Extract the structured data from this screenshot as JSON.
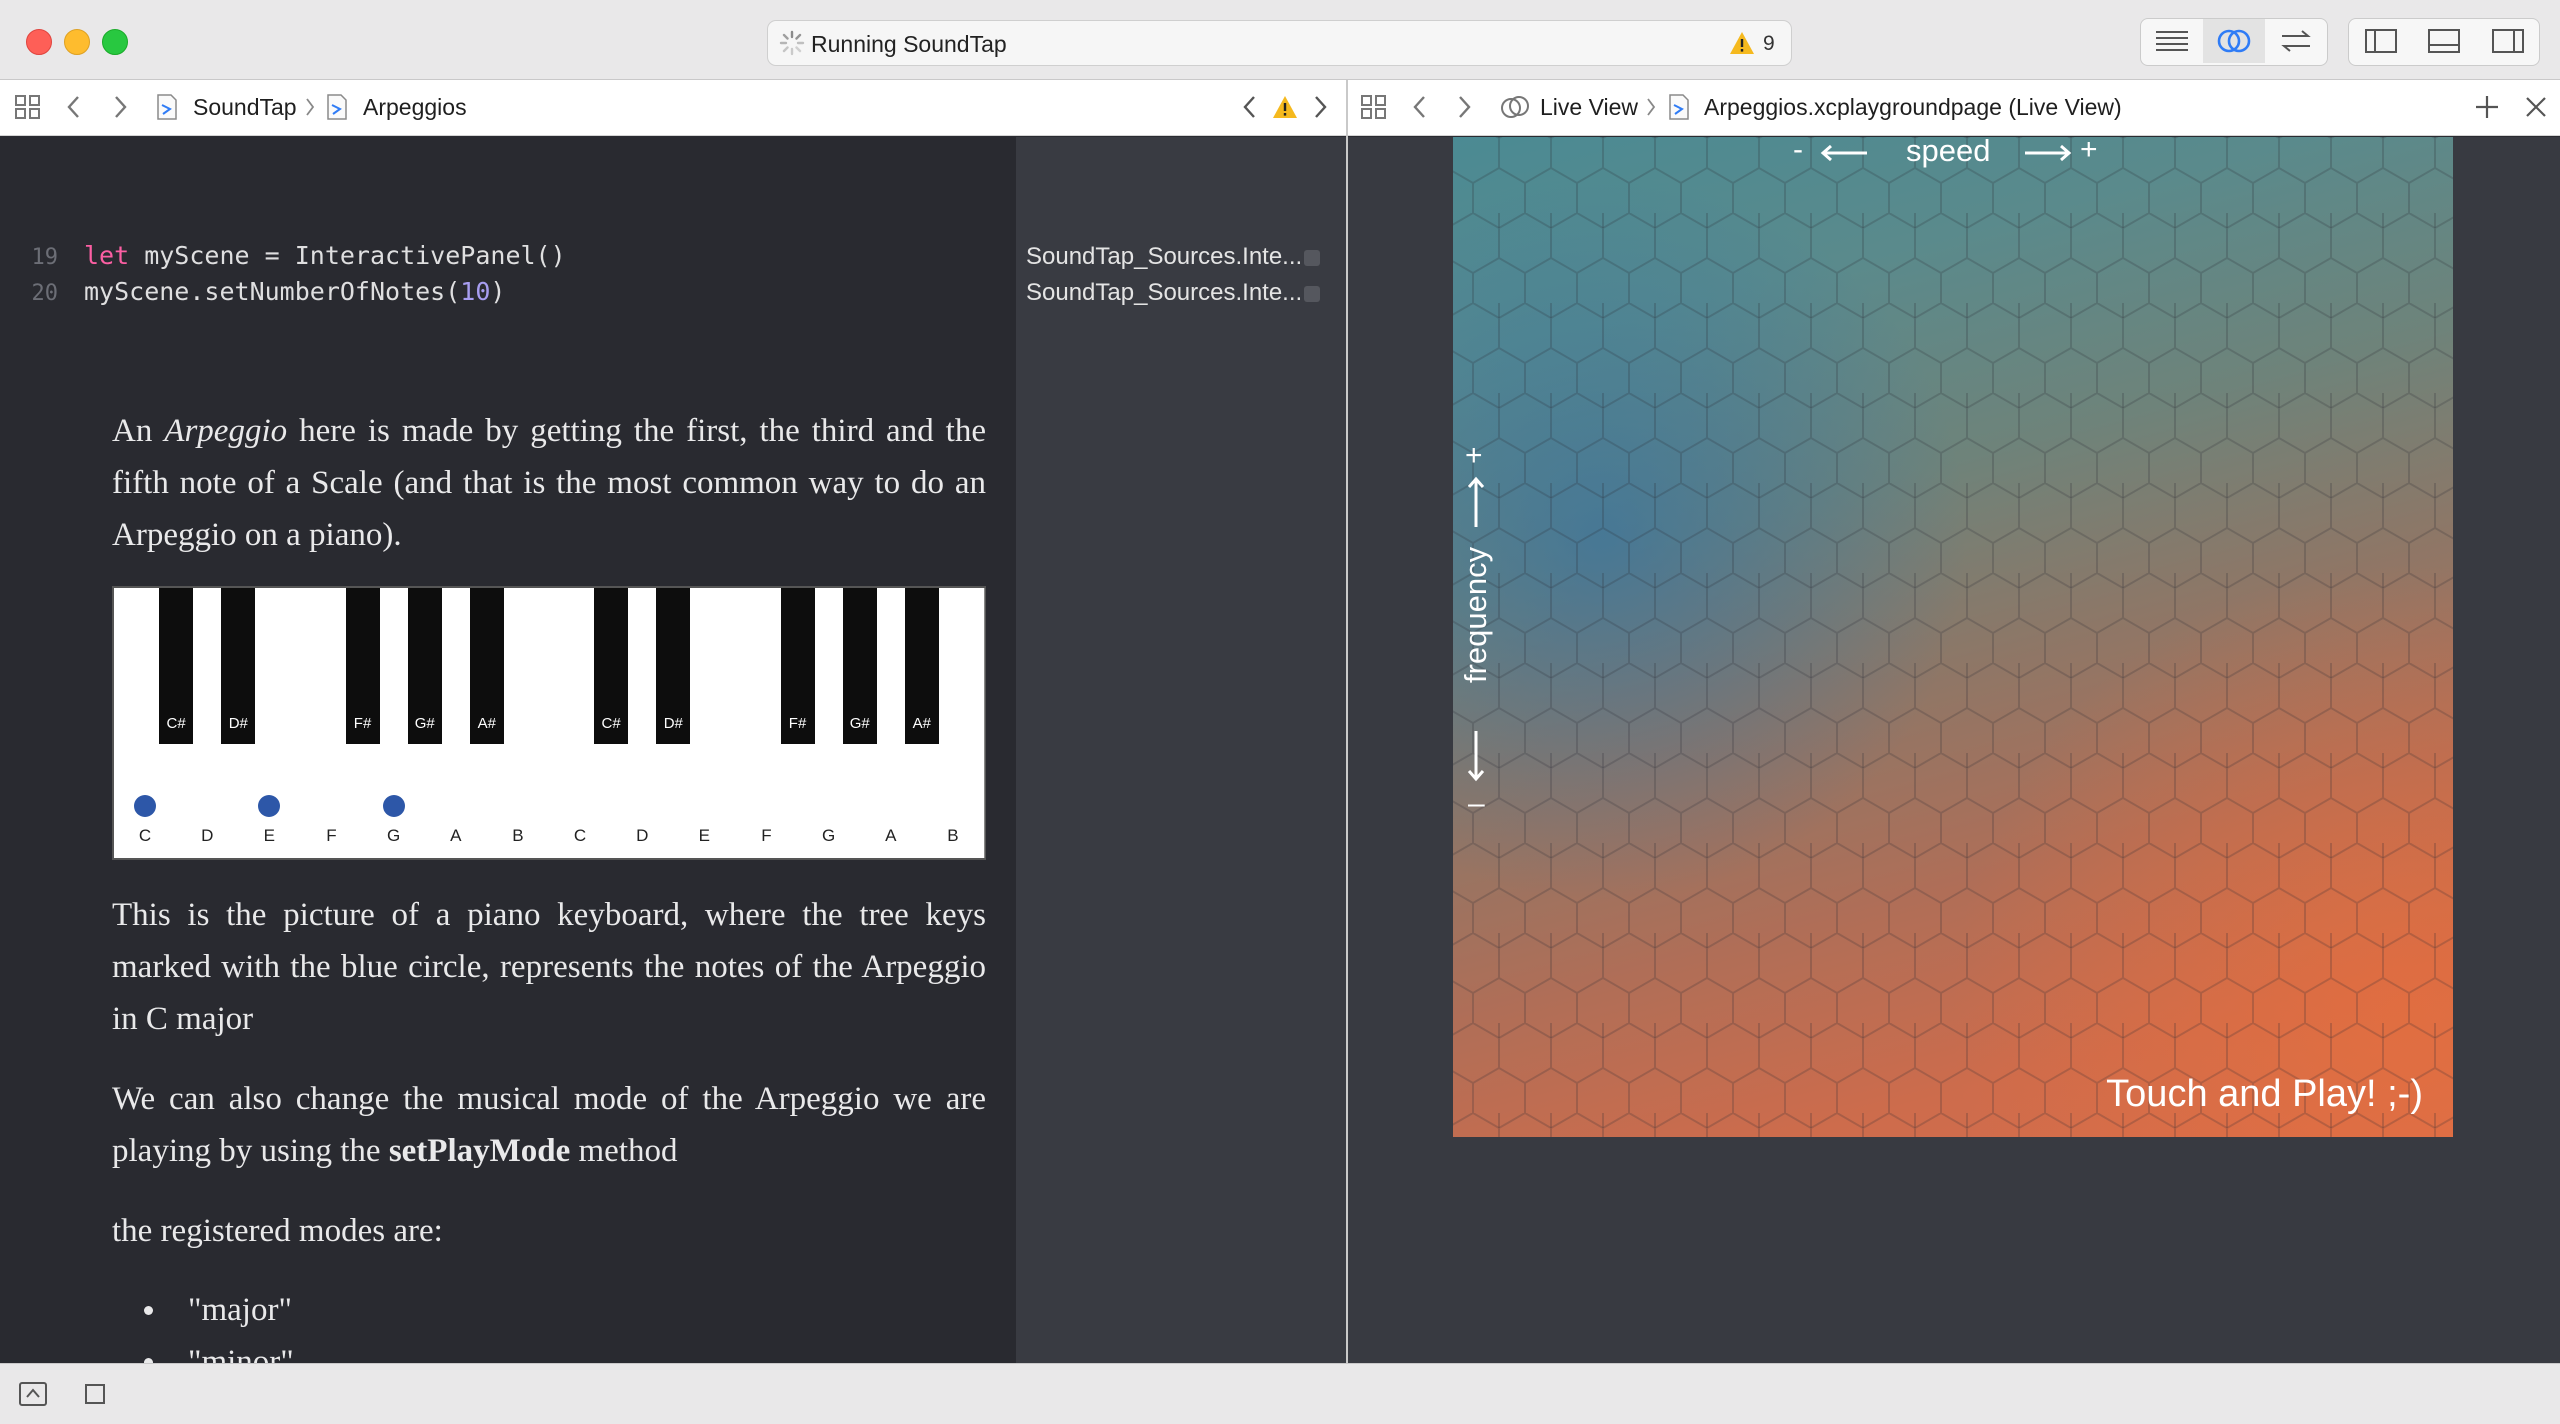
{
  "window": {
    "activity_text": "Running SoundTap",
    "warning_count": "9"
  },
  "editor_jumpbar": {
    "project": "SoundTap",
    "page": "Arpeggios"
  },
  "live_jumpbar": {
    "section": "Live View",
    "file": "Arpeggios.xcplaygroundpage (Live View)"
  },
  "code": {
    "lines": [
      {
        "number": "19",
        "keyword": "let",
        "rest": " myScene = InteractivePanel()"
      },
      {
        "number": "20",
        "prefix": "myScene.setNumberOfNotes(",
        "number_arg": "10",
        "suffix": ")"
      }
    ]
  },
  "results": {
    "line19": "SoundTap_Sources.Inte...",
    "line20": "SoundTap_Sources.Inte..."
  },
  "prose": {
    "p1_a": "An ",
    "p1_em": "Arpeggio",
    "p1_b": " here is made by getting the first, the third and the fifth note of a Scale (and that is the most common way to do an Arpeggio on a piano).",
    "p2": "This is the picture of a piano keyboard, where the tree keys marked with the blue circle, represents the notes of the Arpeggio in C major",
    "p3_a": "We can also change the musical mode of the Arpeggio we are playing by using the ",
    "p3_strong": "setPlayMode",
    "p3_b": " method",
    "p4": "the registered modes are:",
    "modes": [
      "\"major\"",
      "\"minor\""
    ]
  },
  "piano": {
    "white_keys": [
      "C",
      "D",
      "E",
      "F",
      "G",
      "A",
      "B",
      "C",
      "D",
      "E",
      "F",
      "G",
      "A",
      "B"
    ],
    "black_keys": [
      "C#",
      "D#",
      "F#",
      "G#",
      "A#",
      "C#",
      "D#",
      "F#",
      "G#",
      "A#"
    ],
    "marked_keys": [
      "C",
      "E",
      "G"
    ],
    "marker_color": "#2d57a8"
  },
  "live_view": {
    "speed_label": "speed",
    "speed_minus": "-",
    "speed_plus": "+",
    "frequency_label": "frequency",
    "freq_plus": "+",
    "freq_minus": "–",
    "touch_text": "Touch and Play! ;-)"
  }
}
